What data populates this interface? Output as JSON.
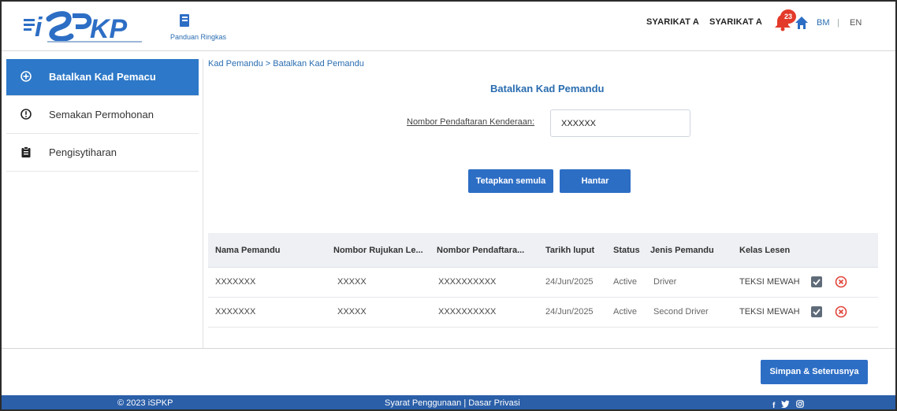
{
  "header": {
    "logo_text": "iSPKP",
    "guide_label": "Panduan Ringkas",
    "company_1": "SYARIKAT A",
    "company_2": "SYARIKAT A",
    "notification_count": "23",
    "lang_bm": "BM",
    "lang_separator": "|",
    "lang_en": "EN"
  },
  "sidebar": {
    "items": [
      {
        "label": "Batalkan Kad Pemacu",
        "icon": "plus-circle-icon",
        "active": true
      },
      {
        "label": "Semakan Permohonan",
        "icon": "alert-circle-icon",
        "active": false
      },
      {
        "label": "Pengisytiharan",
        "icon": "clipboard-icon",
        "active": false
      }
    ]
  },
  "main": {
    "breadcrumb": "Kad Pemandu > Batalkan Kad Pemandu",
    "title": "Batalkan Kad Pemandu",
    "field_label": "Nombor Pendaftaran Kenderaan:",
    "field_value": "XXXXXX",
    "reset_label": "Tetapkan semula",
    "submit_label": "Hantar"
  },
  "table": {
    "headers": [
      "Nama Pemandu",
      "Nombor Rujukan Le...",
      "Nombor Pendaftara...",
      "Tarikh luput",
      "Status",
      "Jenis Pemandu",
      "Kelas Lesen"
    ],
    "rows": [
      [
        "XXXXXXX",
        "XXXXX",
        "XXXXXXXXXX",
        "24/Jun/2025",
        "Active",
        "Driver",
        "TEKSI MEWAH"
      ],
      [
        "XXXXXXX",
        "XXXXX",
        "XXXXXXXXXX",
        "24/Jun/2025",
        "Active",
        "Second Driver",
        "TEKSI MEWAH"
      ]
    ]
  },
  "actions": {
    "next_label": "Simpan & Seterusnya"
  },
  "footer": {
    "copyright": "© 2023 iSPKP",
    "terms": "Syarat Penggunaan",
    "separator": "|",
    "privacy": "Dasar Privasi",
    "social": [
      "facebook-icon",
      "twitter-icon",
      "instagram-icon"
    ]
  },
  "colors": {
    "primary": "#2d6ec5",
    "sidebar_active": "#2d78c8",
    "footer": "#2b5fa8",
    "badge": "#e33a2a",
    "delete": "#e0443a",
    "link": "#2a6db0"
  }
}
